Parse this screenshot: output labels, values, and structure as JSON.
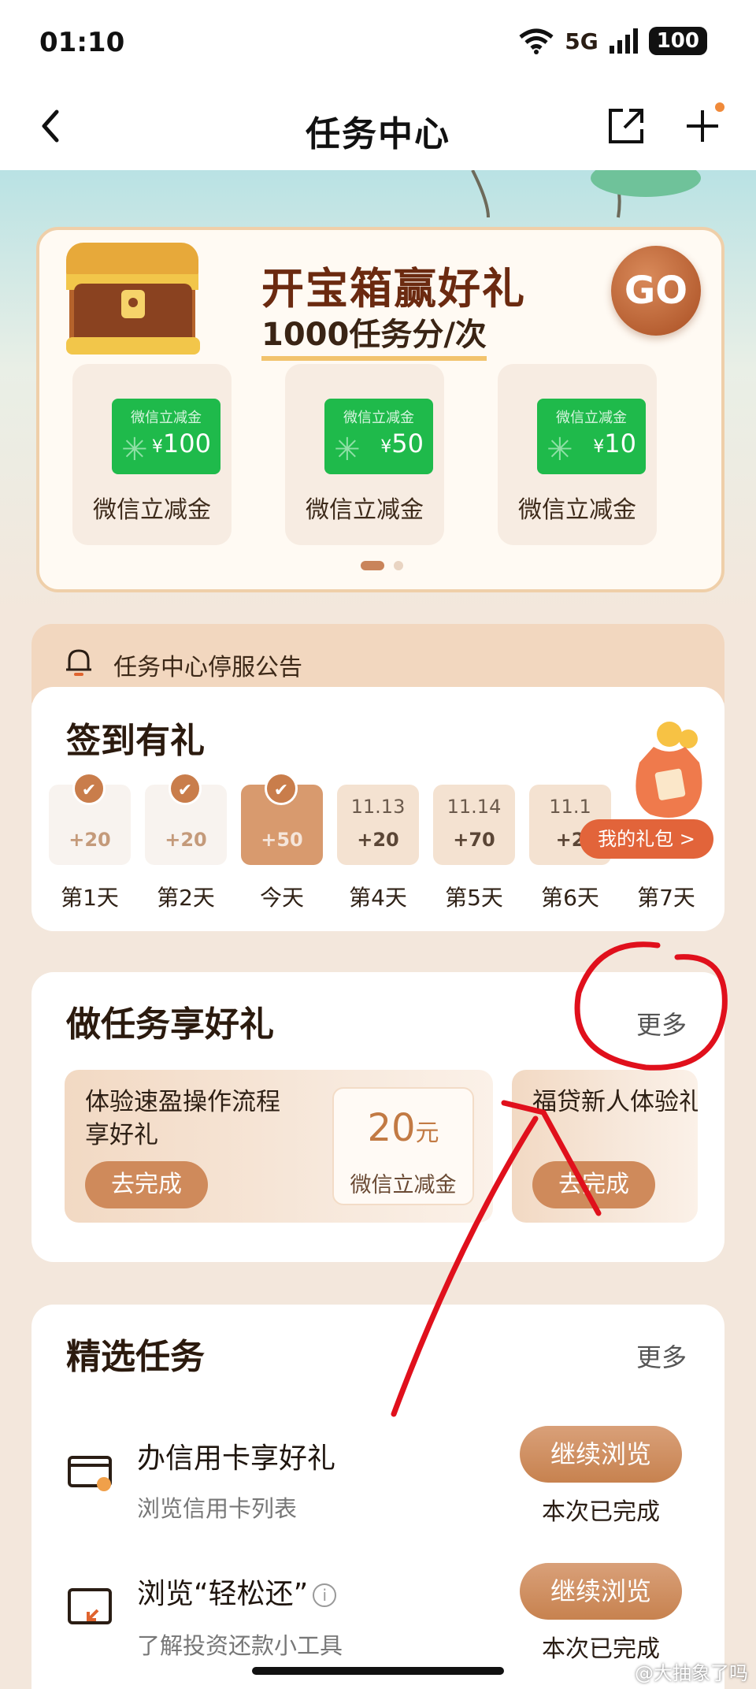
{
  "status_bar": {
    "time": "01:10",
    "network": "5G",
    "battery": "100"
  },
  "nav": {
    "title": "任务中心"
  },
  "treasure": {
    "title": "开宝箱赢好礼",
    "subtitle": "1000任务分/次",
    "go_label": "GO",
    "prizes": [
      {
        "ticket_label": "微信立减金",
        "amount": "100",
        "label": "微信立减金"
      },
      {
        "ticket_label": "微信立减金",
        "amount": "50",
        "label": "微信立减金"
      },
      {
        "ticket_label": "微信立减金",
        "amount": "10",
        "label": "微信立减金"
      }
    ],
    "currency": "¥"
  },
  "notice": {
    "text": "任务中心停服公告"
  },
  "signin": {
    "title": "签到有礼",
    "gift_button": "我的礼包 >",
    "days": [
      {
        "label": "第1天",
        "date": "",
        "points": "+20",
        "checked": true
      },
      {
        "label": "第2天",
        "date": "",
        "points": "+20",
        "checked": true
      },
      {
        "label": "今天",
        "date": "",
        "points": "+50",
        "checked": true
      },
      {
        "label": "第4天",
        "date": "11.13",
        "points": "+20",
        "checked": false
      },
      {
        "label": "第5天",
        "date": "11.14",
        "points": "+70",
        "checked": false
      },
      {
        "label": "第6天",
        "date": "11.1",
        "points": "+2",
        "checked": false
      },
      {
        "label": "第7天",
        "date": "",
        "points": "",
        "checked": false
      }
    ]
  },
  "tasks": {
    "title": "做任务享好礼",
    "more": "更多",
    "items": [
      {
        "text": "体验速盈操作流程享好礼",
        "button": "去完成",
        "reward_amount": "20",
        "reward_unit": "元",
        "reward_label": "微信立减金"
      },
      {
        "text": "福贷新人体验礼",
        "button": "去完成"
      }
    ]
  },
  "picked": {
    "title": "精选任务",
    "more": "更多",
    "items": [
      {
        "title": "办信用卡享好礼",
        "subtitle": "浏览信用卡列表",
        "button": "继续浏览",
        "status": "本次已完成"
      },
      {
        "title": "浏览“轻松还”",
        "subtitle": "了解投资还款小工具",
        "button": "继续浏览",
        "status": "本次已完成"
      }
    ]
  },
  "watermark": "@大抽象了吗"
}
